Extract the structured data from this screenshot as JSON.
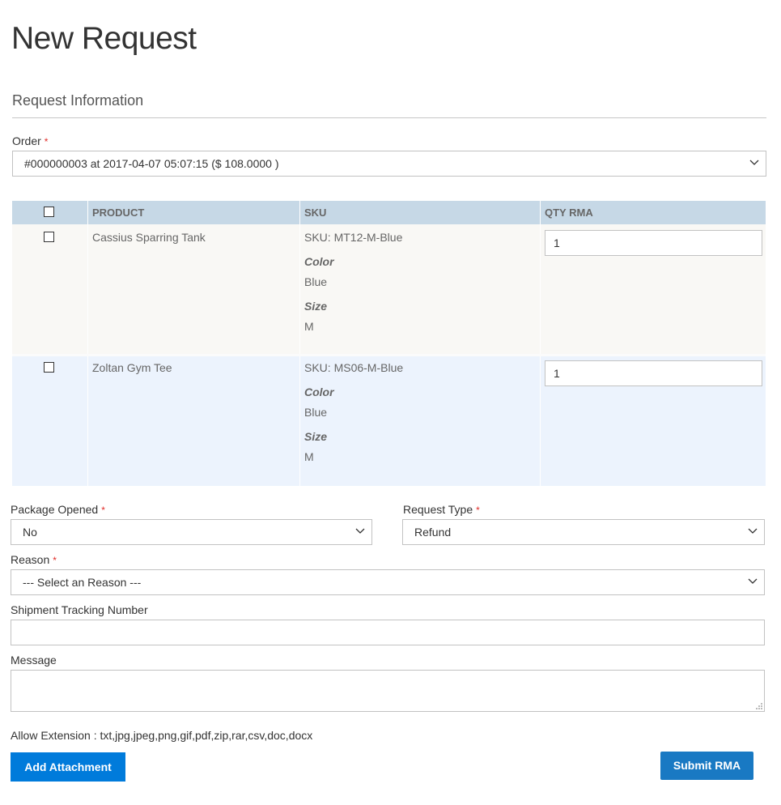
{
  "page": {
    "title": "New Request",
    "section_title": "Request Information"
  },
  "order": {
    "label": "Order",
    "required_mark": "*",
    "selected": "#000000003 at 2017-04-07 05:07:15 ($ 108.0000 )"
  },
  "items_table": {
    "columns": [
      "",
      "PRODUCT",
      "SKU",
      "QTY RMA"
    ],
    "rows": [
      {
        "product": "Cassius Sparring Tank",
        "sku": "SKU: MT12-M-Blue",
        "attributes": [
          {
            "label": "Color",
            "value": "Blue"
          },
          {
            "label": "Size",
            "value": "M"
          }
        ],
        "qty": "1",
        "checked": false
      },
      {
        "product": "Zoltan Gym Tee",
        "sku": "SKU: MS06-M-Blue",
        "attributes": [
          {
            "label": "Color",
            "value": "Blue"
          },
          {
            "label": "Size",
            "value": "M"
          }
        ],
        "qty": "1",
        "checked": false
      }
    ]
  },
  "package_opened": {
    "label": "Package Opened",
    "required_mark": "*",
    "selected": "No"
  },
  "request_type": {
    "label": "Request Type",
    "required_mark": "*",
    "selected": "Refund"
  },
  "reason": {
    "label": "Reason",
    "required_mark": "*",
    "selected": "--- Select an Reason ---"
  },
  "tracking": {
    "label": "Shipment Tracking Number",
    "value": ""
  },
  "message": {
    "label": "Message",
    "value": ""
  },
  "attachments": {
    "allow_extension_text": "Allow Extension : txt,jpg,jpeg,png,gif,pdf,zip,rar,csv,doc,docx",
    "add_button": "Add Attachment"
  },
  "submit_button": "Submit RMA",
  "colors": {
    "primary_button": "#007bdb",
    "submit_button": "#1979c3",
    "required": "#e02b27",
    "table_header": "#c6d8e6",
    "row_odd": "#f9f8f5",
    "row_even": "#ecf3fd"
  }
}
